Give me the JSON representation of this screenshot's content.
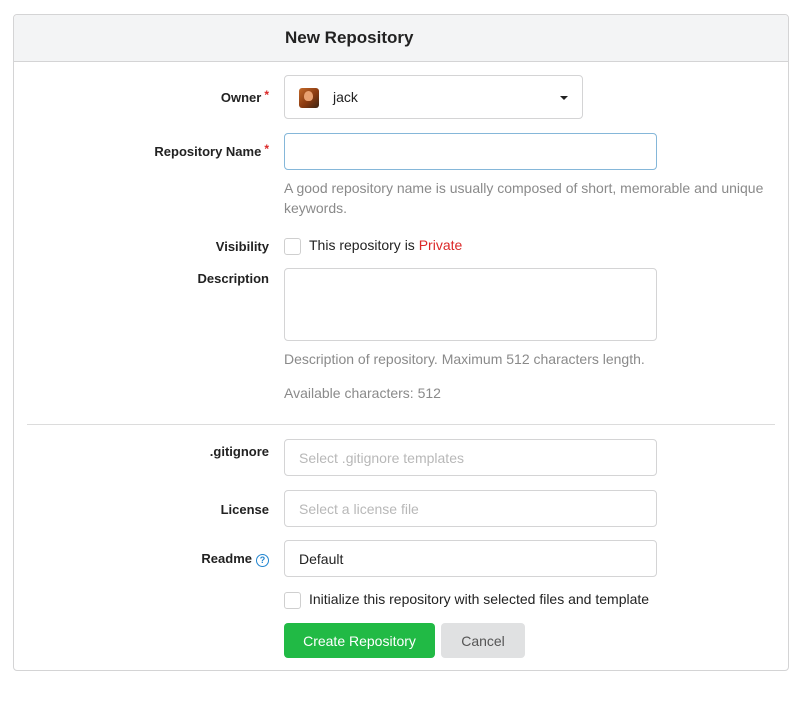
{
  "header": {
    "title": "New Repository"
  },
  "owner": {
    "label": "Owner",
    "required": "*",
    "selected": "jack"
  },
  "repo_name": {
    "label": "Repository Name",
    "required": "*",
    "value": "",
    "help": "A good repository name is usually composed of short, memorable and unique keywords."
  },
  "visibility": {
    "label": "Visibility",
    "text": "This repository is ",
    "private_word": "Private",
    "checked": false
  },
  "description": {
    "label": "Description",
    "value": "",
    "help": "Description of repository. Maximum 512 characters length.",
    "available": "Available characters: 512"
  },
  "gitignore": {
    "label": ".gitignore",
    "placeholder": "Select .gitignore templates"
  },
  "license": {
    "label": "License",
    "placeholder": "Select a license file"
  },
  "readme": {
    "label": "Readme",
    "value": "Default",
    "help_icon": "question-circle-icon"
  },
  "initialize": {
    "label": "Initialize this repository with selected files and template",
    "checked": false
  },
  "actions": {
    "create_label": "Create Repository",
    "cancel_label": "Cancel"
  },
  "colors": {
    "primary": "#21ba45",
    "required": "#db2828",
    "focus_border": "#85b7d9",
    "help_text": "#8a8a8a",
    "info": "#2185d0"
  }
}
